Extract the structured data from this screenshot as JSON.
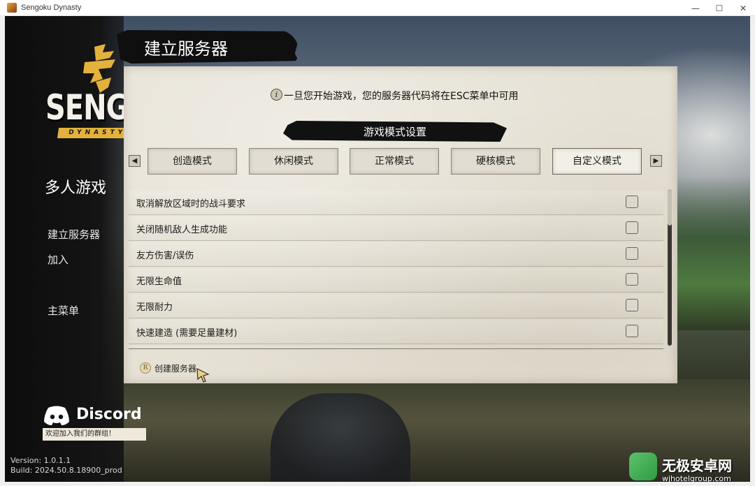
{
  "window": {
    "title": "Sengoku Dynasty",
    "minimize_glyph": "—",
    "maximize_glyph": "☐",
    "close_glyph": "✕"
  },
  "logo": {
    "main": "SENGOKU",
    "sub": "DYNASTY"
  },
  "header": {
    "title": "建立服务器"
  },
  "sidebar": {
    "heading": "多人游戏",
    "items": [
      {
        "label": "建立服务器"
      },
      {
        "label": "加入"
      },
      {
        "label": "主菜单"
      }
    ]
  },
  "info": {
    "icon_glyph": "i",
    "text": "一旦您开始游戏，您的服务器代码将在ESC菜单中可用"
  },
  "game_mode": {
    "title": "游戏模式设置",
    "prev_glyph": "◀",
    "next_glyph": "▶",
    "tabs": [
      {
        "label": "创造模式",
        "active": false
      },
      {
        "label": "休闲模式",
        "active": false
      },
      {
        "label": "正常模式",
        "active": false
      },
      {
        "label": "硬核模式",
        "active": false
      },
      {
        "label": "自定义模式",
        "active": true
      }
    ]
  },
  "options": [
    {
      "label": "取消解放区域时的战斗要求",
      "checked": false
    },
    {
      "label": "关闭随机敌人生成功能",
      "checked": false
    },
    {
      "label": "友方伤害/误伤",
      "checked": false
    },
    {
      "label": "无限生命值",
      "checked": false
    },
    {
      "label": "无限耐力",
      "checked": false
    },
    {
      "label": "快速建造 (需要足量建材)",
      "checked": false
    }
  ],
  "footer": {
    "key_glyph": "R",
    "create_label": "创建服务器"
  },
  "discord": {
    "name": "Discord",
    "banner": "欢迎加入我们的群组！"
  },
  "version": {
    "version_line": "Version: 1.0.1.1",
    "build_line": "Build: 2024.50.8.18900_prod"
  },
  "watermark": {
    "title": "无极安卓网",
    "url": "wjhotelgroup.com"
  },
  "colors": {
    "parchment": "#e6e1d5",
    "brush": "#111111",
    "logo_accent": "#e3b23c"
  }
}
